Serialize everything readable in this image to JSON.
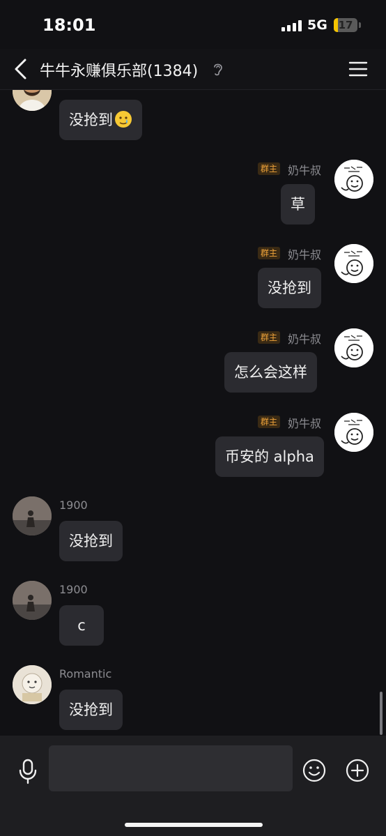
{
  "status_bar": {
    "time": "18:01",
    "network": "5G",
    "battery_level": "17",
    "battery_fraction": 0.17
  },
  "header": {
    "title": "牛牛永赚俱乐部(1384)"
  },
  "roles": {
    "owner_badge": "群主"
  },
  "messages": [
    {
      "sender": "",
      "side": "left",
      "text": "没抢到",
      "emoji": "tearful-smile-emoji"
    },
    {
      "sender": "奶牛叔",
      "side": "right",
      "badge": true,
      "text": "草"
    },
    {
      "sender": "奶牛叔",
      "side": "right",
      "badge": true,
      "text": "没抢到"
    },
    {
      "sender": "奶牛叔",
      "side": "right",
      "badge": true,
      "text": "怎么会这样"
    },
    {
      "sender": "奶牛叔",
      "side": "right",
      "badge": true,
      "text": "币安的 alpha"
    },
    {
      "sender": "1900",
      "side": "left",
      "text": "没抢到"
    },
    {
      "sender": "1900",
      "side": "left",
      "text": "c"
    },
    {
      "sender": "Romantic",
      "side": "left",
      "text": "没抢到"
    }
  ],
  "input": {
    "placeholder": ""
  },
  "icons": {
    "back": "chevron-left-icon",
    "ear": "ear-icon",
    "menu": "hamburger-menu-icon",
    "mic": "microphone-icon",
    "emoji": "smiley-icon",
    "add": "plus-circle-icon"
  },
  "colors": {
    "background": "#111114",
    "bubble": "#2b2b30",
    "badge_text": "#f0a43a",
    "battery": "#f5c400"
  }
}
